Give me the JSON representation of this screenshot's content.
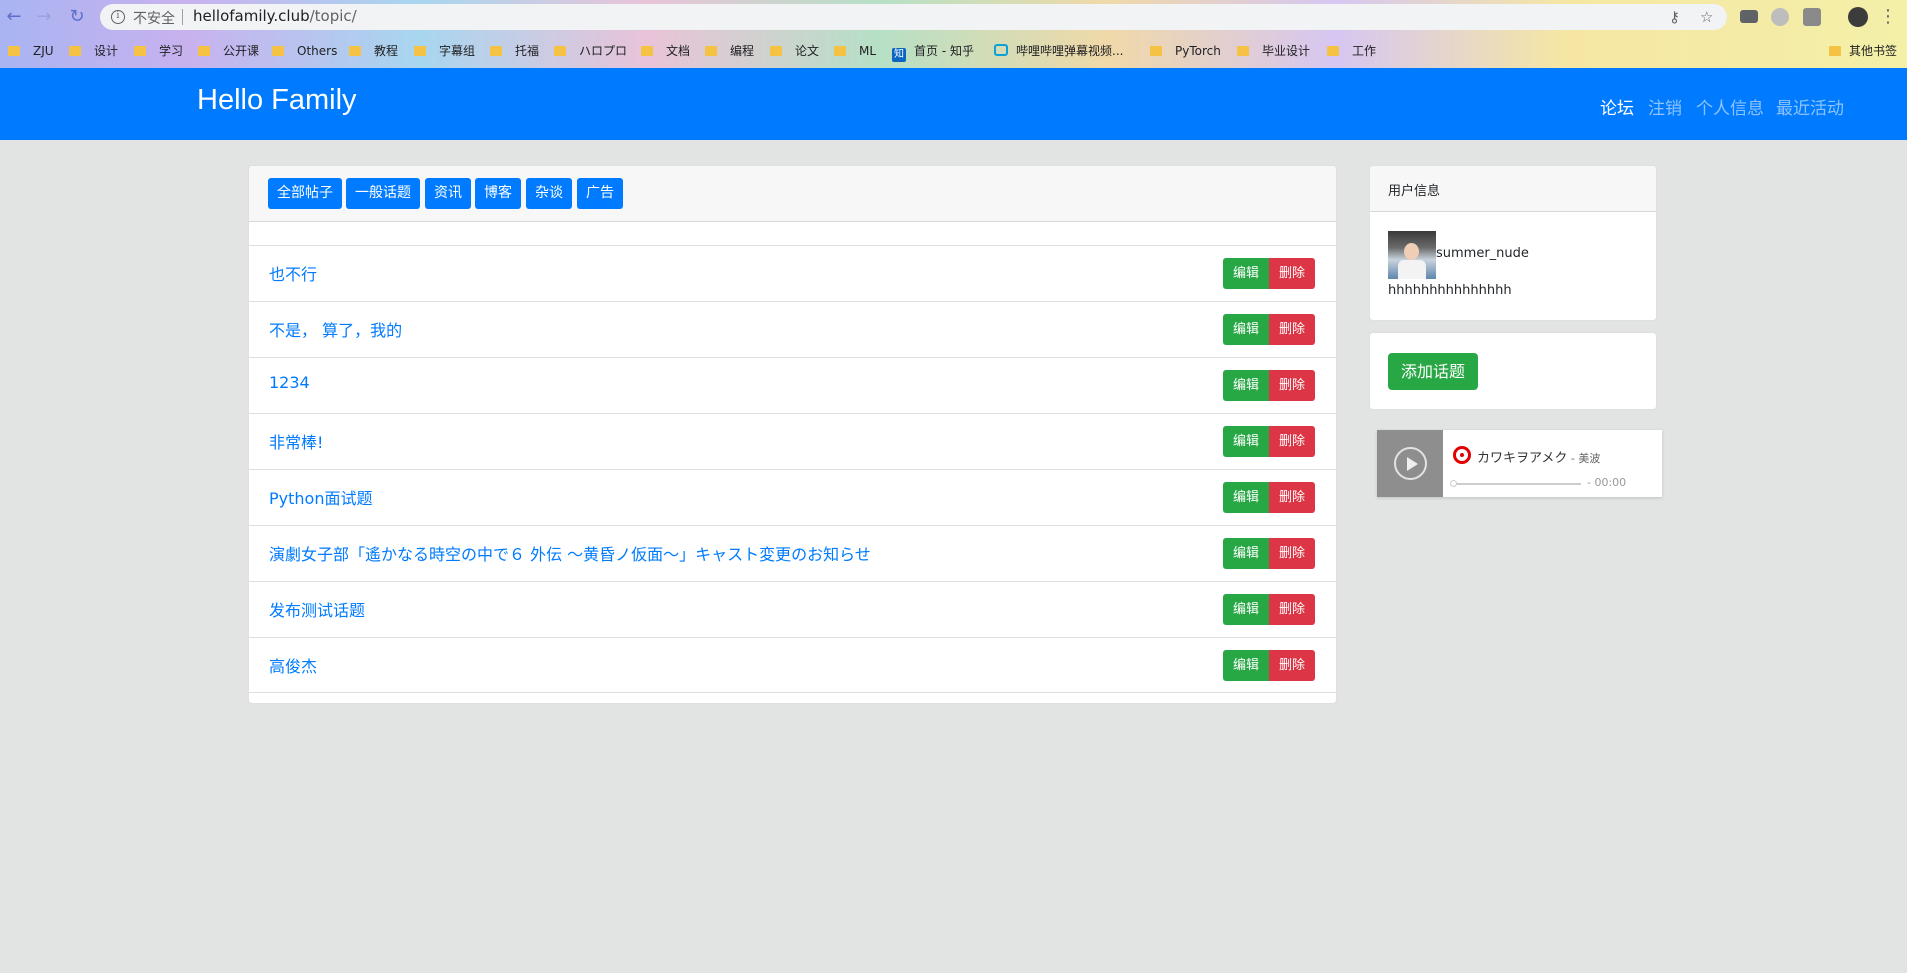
{
  "browser": {
    "insecure_label": "不安全",
    "url_domain": "hellofamily.club",
    "url_path": "/topic/",
    "bookmarks": [
      {
        "label": "ZJU",
        "icon": "folder-icon"
      },
      {
        "label": "设计",
        "icon": "folder-icon"
      },
      {
        "label": "学习",
        "icon": "folder-icon"
      },
      {
        "label": "公开课",
        "icon": "folder-icon"
      },
      {
        "label": "Others",
        "icon": "folder-icon"
      },
      {
        "label": "教程",
        "icon": "folder-icon"
      },
      {
        "label": "字幕组",
        "icon": "folder-icon"
      },
      {
        "label": "托福",
        "icon": "folder-icon"
      },
      {
        "label": "ハロプロ",
        "icon": "folder-icon"
      },
      {
        "label": "文档",
        "icon": "folder-icon"
      },
      {
        "label": "编程",
        "icon": "folder-icon"
      },
      {
        "label": "论文",
        "icon": "folder-icon"
      },
      {
        "label": "ML",
        "icon": "folder-icon"
      },
      {
        "label": "首页 - 知乎",
        "icon": "zhihu-icon"
      },
      {
        "label": "哔哩哔哩弹幕视频...",
        "icon": "bilibili-icon"
      },
      {
        "label": "PyTorch",
        "icon": "folder-icon"
      },
      {
        "label": "毕业设计",
        "icon": "folder-icon"
      },
      {
        "label": "工作",
        "icon": "folder-icon"
      }
    ],
    "other_bookmarks": "其他书签",
    "zhihu_glyph": "知"
  },
  "navbar": {
    "brand": "Hello Family",
    "links": [
      {
        "label": "论坛",
        "active": true
      },
      {
        "label": "注销",
        "active": false
      },
      {
        "label": "个人信息",
        "active": false
      },
      {
        "label": "最近活动",
        "active": false
      }
    ]
  },
  "filters": [
    "全部帖子",
    "一般话题",
    "资讯",
    "博客",
    "杂谈",
    "广告"
  ],
  "topics": [
    {
      "title": "也不行"
    },
    {
      "title": "不是， 算了，我的"
    },
    {
      "title": "1234"
    },
    {
      "title": "非常棒!"
    },
    {
      "title": "Python面试题"
    },
    {
      "title": "演劇女子部「遙かなる時空の中で６ 外伝 ～黄昏ノ仮面～」キャスト変更のお知らせ"
    },
    {
      "title": "发布测试话题"
    },
    {
      "title": "高俊杰"
    }
  ],
  "actions": {
    "edit": "编辑",
    "delete": "删除"
  },
  "user_card": {
    "header": "用户信息",
    "username": "summer_nude",
    "bio": "hhhhhhhhhhhhhhh"
  },
  "add_topic": "添加话题",
  "player": {
    "song": "カワキヲアメク",
    "artist": " - 美波",
    "time": "- 00:00",
    "progress": 0
  },
  "colors": {
    "primary": "#007bff",
    "success": "#28a745",
    "danger": "#dc3545",
    "page_bg": "#e2e3e3"
  }
}
